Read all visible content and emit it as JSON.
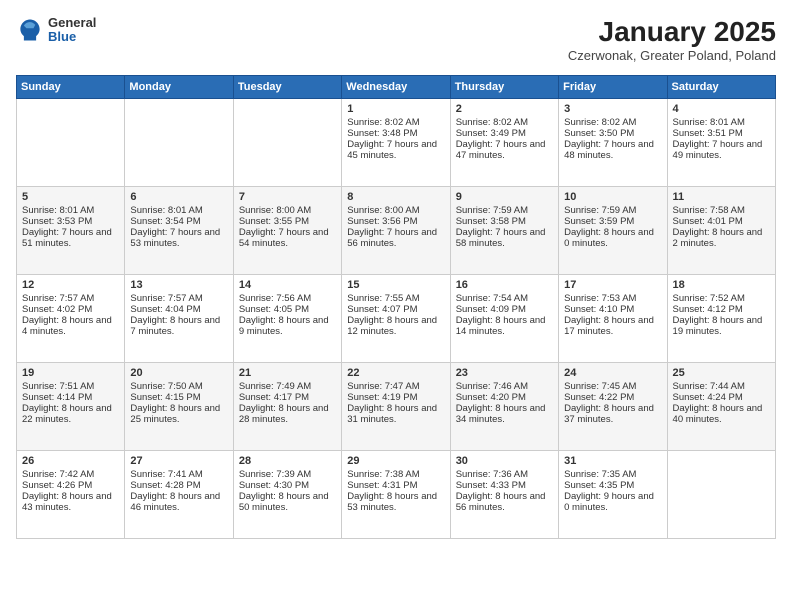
{
  "logo": {
    "general": "General",
    "blue": "Blue"
  },
  "header": {
    "title": "January 2025",
    "subtitle": "Czerwonak, Greater Poland, Poland"
  },
  "days_of_week": [
    "Sunday",
    "Monday",
    "Tuesday",
    "Wednesday",
    "Thursday",
    "Friday",
    "Saturday"
  ],
  "weeks": [
    [
      {
        "day": "",
        "content": ""
      },
      {
        "day": "",
        "content": ""
      },
      {
        "day": "",
        "content": ""
      },
      {
        "day": "1",
        "content": "Sunrise: 8:02 AM\nSunset: 3:48 PM\nDaylight: 7 hours and 45 minutes."
      },
      {
        "day": "2",
        "content": "Sunrise: 8:02 AM\nSunset: 3:49 PM\nDaylight: 7 hours and 47 minutes."
      },
      {
        "day": "3",
        "content": "Sunrise: 8:02 AM\nSunset: 3:50 PM\nDaylight: 7 hours and 48 minutes."
      },
      {
        "day": "4",
        "content": "Sunrise: 8:01 AM\nSunset: 3:51 PM\nDaylight: 7 hours and 49 minutes."
      }
    ],
    [
      {
        "day": "5",
        "content": "Sunrise: 8:01 AM\nSunset: 3:53 PM\nDaylight: 7 hours and 51 minutes."
      },
      {
        "day": "6",
        "content": "Sunrise: 8:01 AM\nSunset: 3:54 PM\nDaylight: 7 hours and 53 minutes."
      },
      {
        "day": "7",
        "content": "Sunrise: 8:00 AM\nSunset: 3:55 PM\nDaylight: 7 hours and 54 minutes."
      },
      {
        "day": "8",
        "content": "Sunrise: 8:00 AM\nSunset: 3:56 PM\nDaylight: 7 hours and 56 minutes."
      },
      {
        "day": "9",
        "content": "Sunrise: 7:59 AM\nSunset: 3:58 PM\nDaylight: 7 hours and 58 minutes."
      },
      {
        "day": "10",
        "content": "Sunrise: 7:59 AM\nSunset: 3:59 PM\nDaylight: 8 hours and 0 minutes."
      },
      {
        "day": "11",
        "content": "Sunrise: 7:58 AM\nSunset: 4:01 PM\nDaylight: 8 hours and 2 minutes."
      }
    ],
    [
      {
        "day": "12",
        "content": "Sunrise: 7:57 AM\nSunset: 4:02 PM\nDaylight: 8 hours and 4 minutes."
      },
      {
        "day": "13",
        "content": "Sunrise: 7:57 AM\nSunset: 4:04 PM\nDaylight: 8 hours and 7 minutes."
      },
      {
        "day": "14",
        "content": "Sunrise: 7:56 AM\nSunset: 4:05 PM\nDaylight: 8 hours and 9 minutes."
      },
      {
        "day": "15",
        "content": "Sunrise: 7:55 AM\nSunset: 4:07 PM\nDaylight: 8 hours and 12 minutes."
      },
      {
        "day": "16",
        "content": "Sunrise: 7:54 AM\nSunset: 4:09 PM\nDaylight: 8 hours and 14 minutes."
      },
      {
        "day": "17",
        "content": "Sunrise: 7:53 AM\nSunset: 4:10 PM\nDaylight: 8 hours and 17 minutes."
      },
      {
        "day": "18",
        "content": "Sunrise: 7:52 AM\nSunset: 4:12 PM\nDaylight: 8 hours and 19 minutes."
      }
    ],
    [
      {
        "day": "19",
        "content": "Sunrise: 7:51 AM\nSunset: 4:14 PM\nDaylight: 8 hours and 22 minutes."
      },
      {
        "day": "20",
        "content": "Sunrise: 7:50 AM\nSunset: 4:15 PM\nDaylight: 8 hours and 25 minutes."
      },
      {
        "day": "21",
        "content": "Sunrise: 7:49 AM\nSunset: 4:17 PM\nDaylight: 8 hours and 28 minutes."
      },
      {
        "day": "22",
        "content": "Sunrise: 7:47 AM\nSunset: 4:19 PM\nDaylight: 8 hours and 31 minutes."
      },
      {
        "day": "23",
        "content": "Sunrise: 7:46 AM\nSunset: 4:20 PM\nDaylight: 8 hours and 34 minutes."
      },
      {
        "day": "24",
        "content": "Sunrise: 7:45 AM\nSunset: 4:22 PM\nDaylight: 8 hours and 37 minutes."
      },
      {
        "day": "25",
        "content": "Sunrise: 7:44 AM\nSunset: 4:24 PM\nDaylight: 8 hours and 40 minutes."
      }
    ],
    [
      {
        "day": "26",
        "content": "Sunrise: 7:42 AM\nSunset: 4:26 PM\nDaylight: 8 hours and 43 minutes."
      },
      {
        "day": "27",
        "content": "Sunrise: 7:41 AM\nSunset: 4:28 PM\nDaylight: 8 hours and 46 minutes."
      },
      {
        "day": "28",
        "content": "Sunrise: 7:39 AM\nSunset: 4:30 PM\nDaylight: 8 hours and 50 minutes."
      },
      {
        "day": "29",
        "content": "Sunrise: 7:38 AM\nSunset: 4:31 PM\nDaylight: 8 hours and 53 minutes."
      },
      {
        "day": "30",
        "content": "Sunrise: 7:36 AM\nSunset: 4:33 PM\nDaylight: 8 hours and 56 minutes."
      },
      {
        "day": "31",
        "content": "Sunrise: 7:35 AM\nSunset: 4:35 PM\nDaylight: 9 hours and 0 minutes."
      },
      {
        "day": "",
        "content": ""
      }
    ]
  ]
}
